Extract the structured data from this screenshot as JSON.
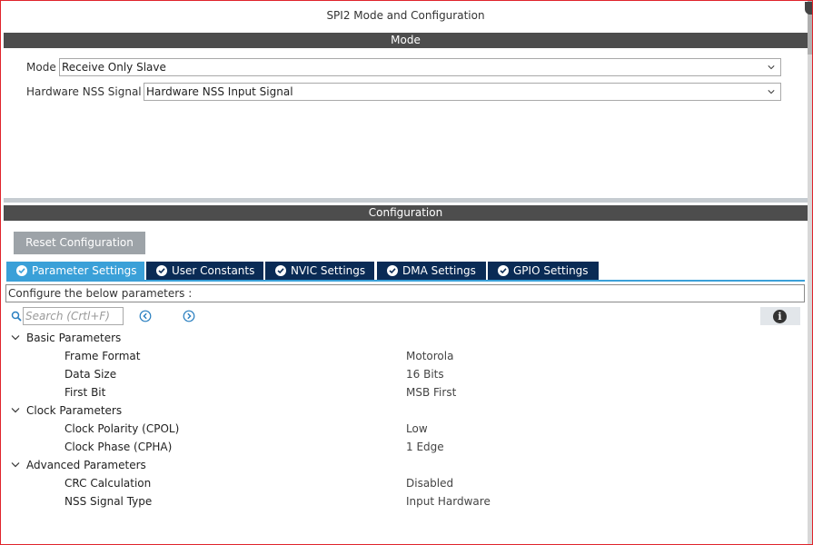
{
  "window": {
    "title": "SPI2 Mode and Configuration"
  },
  "mode_section": {
    "header": "Mode",
    "mode_label": "Mode",
    "mode_value": "Receive Only Slave",
    "nss_label": "Hardware NSS Signal",
    "nss_value": "Hardware NSS Input Signal"
  },
  "config_section": {
    "header": "Configuration",
    "reset_button": "Reset Configuration",
    "tabs": [
      {
        "label": "Parameter Settings",
        "active": true
      },
      {
        "label": "User Constants",
        "active": false
      },
      {
        "label": "NVIC Settings",
        "active": false
      },
      {
        "label": "DMA Settings",
        "active": false
      },
      {
        "label": "GPIO Settings",
        "active": false
      }
    ],
    "hint": "Configure the below parameters :",
    "search_placeholder": "Search (Crtl+F)",
    "info_glyph": "i"
  },
  "parameters": {
    "groups": [
      {
        "label": "Basic Parameters",
        "items": [
          {
            "name": "Frame Format",
            "value": "Motorola"
          },
          {
            "name": "Data Size",
            "value": "16 Bits"
          },
          {
            "name": "First Bit",
            "value": "MSB First"
          }
        ]
      },
      {
        "label": "Clock Parameters",
        "items": [
          {
            "name": "Clock Polarity (CPOL)",
            "value": "Low"
          },
          {
            "name": "Clock Phase (CPHA)",
            "value": "1 Edge"
          }
        ]
      },
      {
        "label": "Advanced Parameters",
        "items": [
          {
            "name": "CRC Calculation",
            "value": "Disabled"
          },
          {
            "name": "NSS Signal Type",
            "value": "Input Hardware"
          }
        ]
      }
    ]
  },
  "icons": {
    "chevron": "chevron-down-icon",
    "check": "check-circle-icon",
    "search": "search-icon",
    "prev": "arrow-left-circle-icon",
    "next": "arrow-right-circle-icon",
    "info": "info-icon",
    "caret": "caret-down-icon"
  },
  "colors": {
    "section_header_bg": "#4d4d4d",
    "tab_bg": "#0a2b55",
    "tab_active_bg": "#3aa0d8",
    "reset_button_bg": "#9da3a8"
  }
}
